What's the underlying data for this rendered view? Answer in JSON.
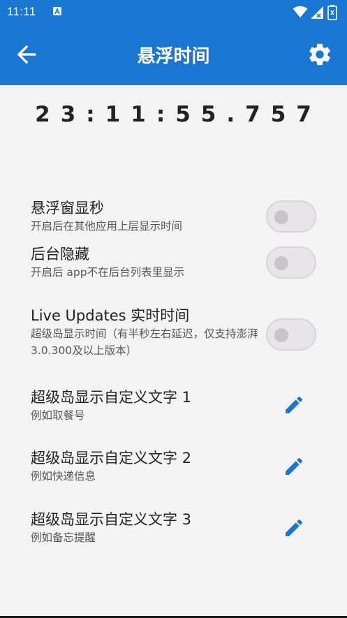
{
  "status_bar": {
    "time": "11:11",
    "app_icon": "a-app-icon",
    "wifi_icon": "wifi-icon",
    "signal_icon": "signal-off-icon",
    "battery_icon": "battery-icon"
  },
  "app_bar": {
    "title": "悬浮时间",
    "back_icon": "arrow-back-icon",
    "settings_icon": "gear-icon"
  },
  "clock": "23:11:55.757",
  "settings": [
    {
      "title": "悬浮窗显秒",
      "subtitle": "开启后在其他应用上层显示时间",
      "control": "switch",
      "checked": false
    },
    {
      "title": "后台隐藏",
      "subtitle": "开启后 app不在后台列表里显示",
      "control": "switch",
      "checked": false
    },
    {
      "title": "Live Updates 实时时间",
      "subtitle": "超级岛显示时间（有半秒左右延迟，仅支持澎湃3.0.300及以上版本）",
      "control": "switch",
      "checked": false
    },
    {
      "title": "超级岛显示自定义文字 1",
      "subtitle": "例如取餐号",
      "control": "edit"
    },
    {
      "title": "超级岛显示自定义文字 2",
      "subtitle": "例如快递信息",
      "control": "edit"
    },
    {
      "title": "超级岛显示自定义文字 3",
      "subtitle": "例如备忘提醒",
      "control": "edit"
    }
  ],
  "colors": {
    "primary": "#1976d2",
    "background": "#f3f3f3",
    "switch_off_track": "#e8e5ea",
    "switch_knob": "#c8c5c8",
    "edit_icon": "#1976d2"
  }
}
